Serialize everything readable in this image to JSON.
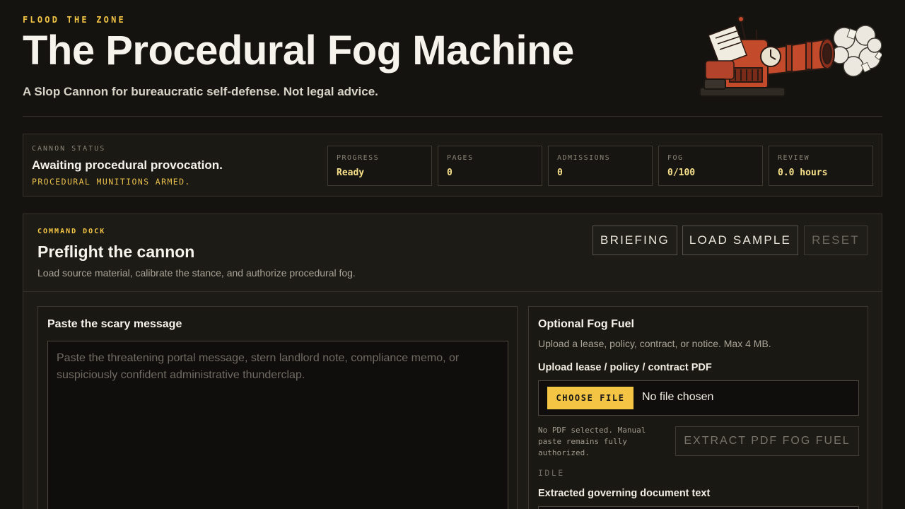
{
  "header": {
    "eyebrow": "FLOOD THE ZONE",
    "title": "The Procedural Fog Machine",
    "subtitle": "A Slop Cannon for bureaucratic self-defense. Not legal advice.",
    "hero_icon": "fog-cannon-illustration"
  },
  "status": {
    "label": "CANNON STATUS",
    "message": "Awaiting procedural provocation.",
    "sub": "PROCEDURAL MUNITIONS ARMED.",
    "stats": [
      {
        "key": "PROGRESS",
        "value": "Ready"
      },
      {
        "key": "PAGES",
        "value": "0"
      },
      {
        "key": "ADMISSIONS",
        "value": "0"
      },
      {
        "key": "FOG",
        "value": "0/100"
      },
      {
        "key": "REVIEW",
        "value": "0.0 hours"
      }
    ]
  },
  "dock": {
    "eyebrow": "COMMAND DOCK",
    "title": "Preflight the cannon",
    "description": "Load source material, calibrate the stance, and authorize procedural fog.",
    "buttons": {
      "briefing": "BRIEFING",
      "load_sample": "LOAD SAMPLE",
      "reset": "RESET"
    }
  },
  "message_card": {
    "title": "Paste the scary message",
    "placeholder": "Paste the threatening portal message, stern landlord note, compliance memo, or suspiciously confident administrative thunderclap."
  },
  "fuel_card": {
    "title": "Optional Fog Fuel",
    "description": "Upload a lease, policy, contract, or notice. Max 4 MB.",
    "upload_label": "Upload lease / policy / contract PDF",
    "choose_file": "CHOOSE FILE",
    "file_status": "No file chosen",
    "pdf_note": "No PDF selected. Manual paste remains fully authorized.",
    "extract_button": "EXTRACT PDF FOG FUEL",
    "state": "IDLE",
    "extracted_label": "Extracted governing document text"
  },
  "colors": {
    "background": "#141310",
    "accent": "#f4c545",
    "stat_value": "#f7e08a"
  }
}
